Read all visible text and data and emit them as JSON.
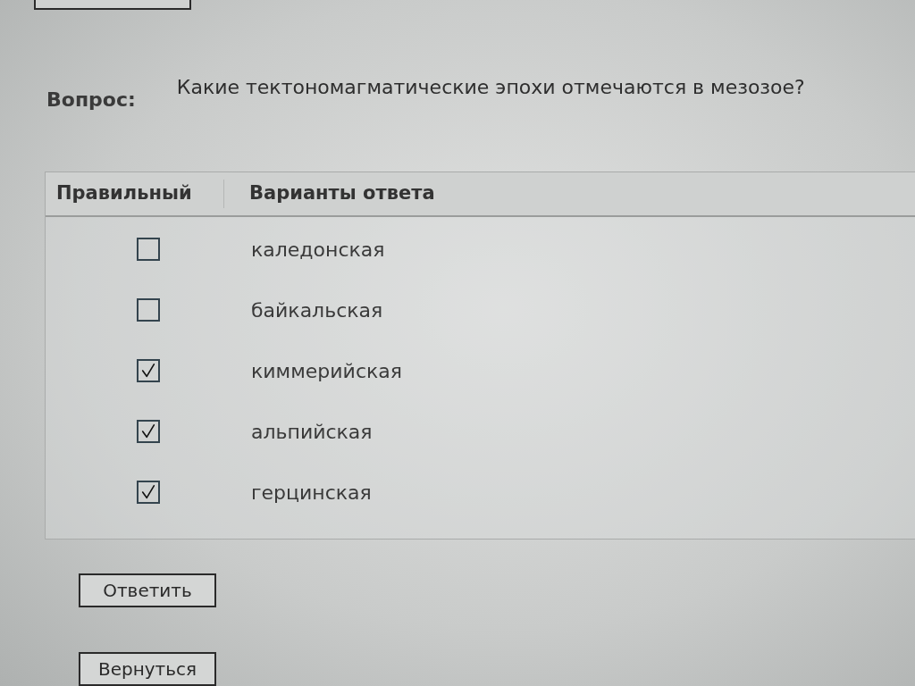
{
  "question": {
    "label": "Вопрос:",
    "text": "Какие тектономагматические эпохи отмечаются в мезозое?"
  },
  "answers_table": {
    "columns": [
      "Правильный",
      "Варианты ответа"
    ],
    "rows": [
      {
        "checked": false,
        "answer": "каледонская"
      },
      {
        "checked": false,
        "answer": "байкальская"
      },
      {
        "checked": true,
        "answer": "киммерийская"
      },
      {
        "checked": true,
        "answer": "альпийская"
      },
      {
        "checked": true,
        "answer": "герцинская"
      }
    ]
  },
  "buttons": [
    "Ответить",
    "Вернуться"
  ]
}
